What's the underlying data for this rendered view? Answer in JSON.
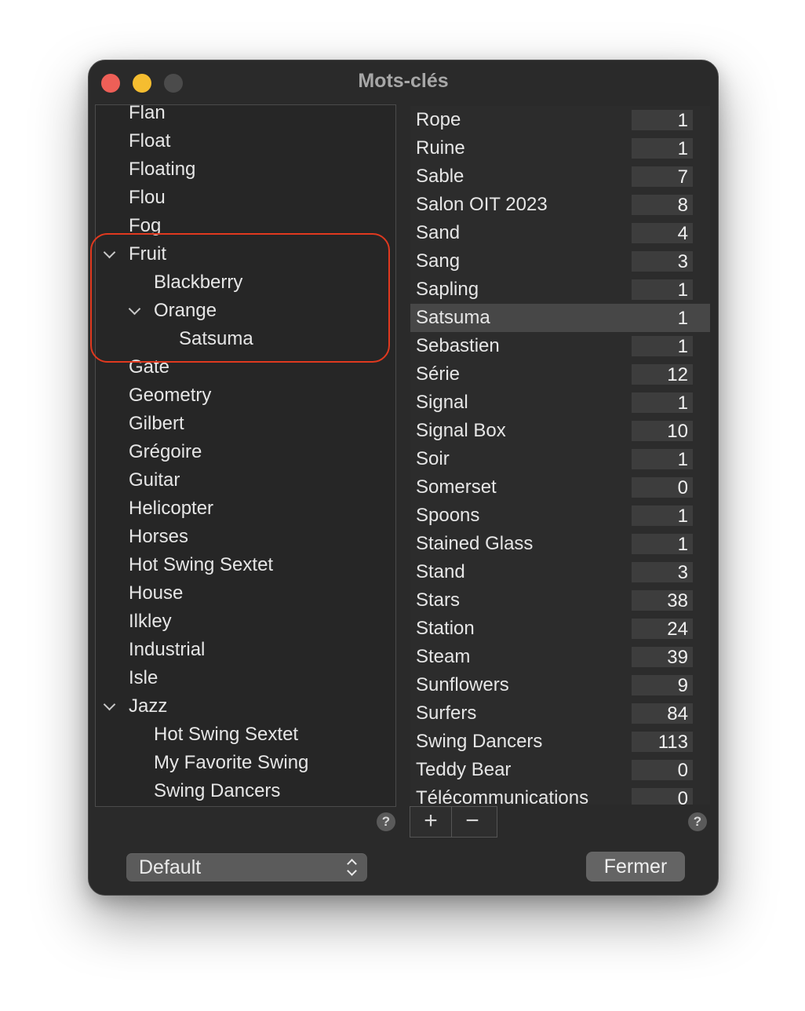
{
  "window": {
    "title": "Mots-clés"
  },
  "tree": {
    "items": [
      {
        "label": "Flan",
        "level": 0,
        "expanded": false
      },
      {
        "label": "Float",
        "level": 0,
        "expanded": false
      },
      {
        "label": "Floating",
        "level": 0,
        "expanded": false
      },
      {
        "label": "Flou",
        "level": 0,
        "expanded": false
      },
      {
        "label": "Fog",
        "level": 0,
        "expanded": false
      },
      {
        "label": "Fruit",
        "level": 0,
        "expanded": true
      },
      {
        "label": "Blackberry",
        "level": 1,
        "expanded": false
      },
      {
        "label": "Orange",
        "level": 1,
        "expanded": true
      },
      {
        "label": "Satsuma",
        "level": 2,
        "expanded": false
      },
      {
        "label": "Gate",
        "level": 0,
        "expanded": false
      },
      {
        "label": "Geometry",
        "level": 0,
        "expanded": false
      },
      {
        "label": "Gilbert",
        "level": 0,
        "expanded": false
      },
      {
        "label": "Grégoire",
        "level": 0,
        "expanded": false
      },
      {
        "label": "Guitar",
        "level": 0,
        "expanded": false
      },
      {
        "label": "Helicopter",
        "level": 0,
        "expanded": false
      },
      {
        "label": "Horses",
        "level": 0,
        "expanded": false
      },
      {
        "label": "Hot Swing Sextet",
        "level": 0,
        "expanded": false
      },
      {
        "label": "House",
        "level": 0,
        "expanded": false
      },
      {
        "label": "Ilkley",
        "level": 0,
        "expanded": false
      },
      {
        "label": "Industrial",
        "level": 0,
        "expanded": false
      },
      {
        "label": "Isle",
        "level": 0,
        "expanded": false
      },
      {
        "label": "Jazz",
        "level": 0,
        "expanded": true
      },
      {
        "label": "Hot Swing Sextet",
        "level": 1,
        "expanded": false
      },
      {
        "label": "My Favorite Swing",
        "level": 1,
        "expanded": false
      },
      {
        "label": "Swing Dancers",
        "level": 1,
        "expanded": false
      }
    ]
  },
  "keywords": {
    "selected": "Satsuma",
    "items": [
      {
        "name": "Rope",
        "count": "1"
      },
      {
        "name": "Ruine",
        "count": "1"
      },
      {
        "name": "Sable",
        "count": "7"
      },
      {
        "name": "Salon OIT 2023",
        "count": "8"
      },
      {
        "name": "Sand",
        "count": "4"
      },
      {
        "name": "Sang",
        "count": "3"
      },
      {
        "name": "Sapling",
        "count": "1"
      },
      {
        "name": "Satsuma",
        "count": "1"
      },
      {
        "name": "Sebastien",
        "count": "1"
      },
      {
        "name": "Série",
        "count": "12"
      },
      {
        "name": "Signal",
        "count": "1"
      },
      {
        "name": "Signal Box",
        "count": "10"
      },
      {
        "name": "Soir",
        "count": "1"
      },
      {
        "name": "Somerset",
        "count": "0"
      },
      {
        "name": "Spoons",
        "count": "1"
      },
      {
        "name": "Stained Glass",
        "count": "1"
      },
      {
        "name": "Stand",
        "count": "3"
      },
      {
        "name": "Stars",
        "count": "38"
      },
      {
        "name": "Station",
        "count": "24"
      },
      {
        "name": "Steam",
        "count": "39"
      },
      {
        "name": "Sunflowers",
        "count": "9"
      },
      {
        "name": "Surfers",
        "count": "84"
      },
      {
        "name": "Swing Dancers",
        "count": "113"
      },
      {
        "name": "Teddy Bear",
        "count": "0"
      },
      {
        "name": "Télécommunications",
        "count": "0"
      }
    ]
  },
  "controls": {
    "add_label": "+",
    "remove_label": "−",
    "help_label": "?",
    "set_popup_value": "Default",
    "close_label": "Fermer"
  },
  "colors": {
    "window_bg": "#2a2a2a",
    "highlight_outline": "#e0391f",
    "traffic_close": "#ee5f57",
    "traffic_min": "#f5bd30"
  },
  "icons": {
    "close": "close-circle-icon",
    "minimize": "minimize-circle-icon",
    "zoom": "zoom-circle-icon",
    "disclosure": "chevron-down-icon",
    "popup": "updown-arrows-icon"
  }
}
